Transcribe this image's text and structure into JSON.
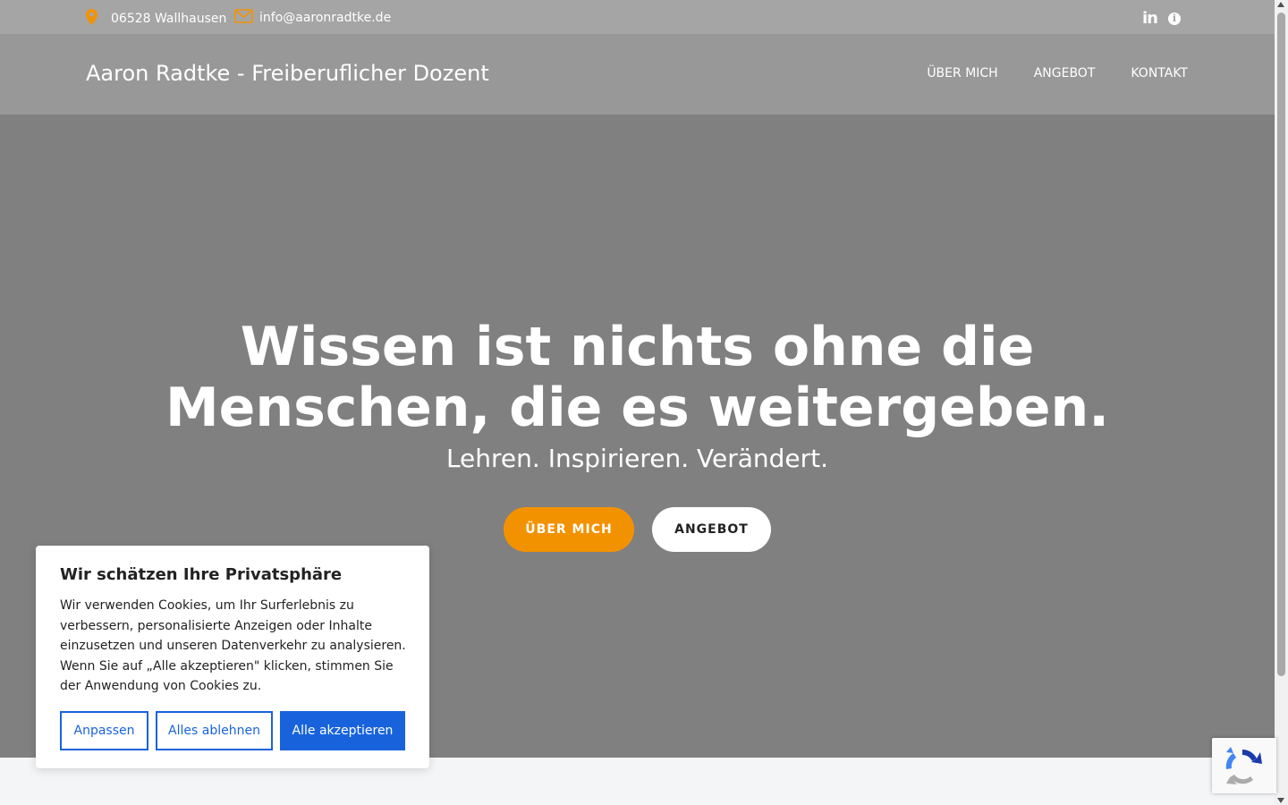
{
  "topbar": {
    "location": "06528 Wallhausen",
    "email": "info@aaronradtke.de",
    "icons": [
      "map-pin-icon",
      "envelope-icon",
      "linkedin-icon",
      "info-icon"
    ],
    "linkedin_glyph": "in",
    "info_glyph": "i"
  },
  "navbar": {
    "brand": "Aaron Radtke - Freiberuflicher Dozent",
    "menu": [
      "ÜBER MICH",
      "ANGEBOT",
      "KONTAKT"
    ]
  },
  "hero": {
    "headline_line1": "Wissen ist nichts ohne die",
    "headline_line2": "Menschen, die es weitergeben.",
    "subline": "Lehren. Inspirieren. Verändert.",
    "primary_button": "ÜBER MICH",
    "secondary_button": "ANGEBOT"
  },
  "cookie_banner": {
    "title": "Wir schätzen Ihre Privatsphäre",
    "text": "Wir verwenden Cookies, um Ihr Surferlebnis zu verbessern, personalisierte Anzeigen oder Inhalte einzusetzen und unseren Datenverkehr zu analysieren. Wenn Sie auf „Alle akzeptieren\" klicken, stimmen Sie der Anwendung von Cookies zu.",
    "customize_button": "Anpassen",
    "reject_button": "Alles ablehnen",
    "accept_button": "Alle akzeptieren"
  },
  "colors": {
    "accent_orange": "#f39200",
    "consent_blue": "#1863dc",
    "topbar_bg": "#a5a5a5",
    "navbar_bg": "#989898",
    "hero_bg": "#808080"
  }
}
